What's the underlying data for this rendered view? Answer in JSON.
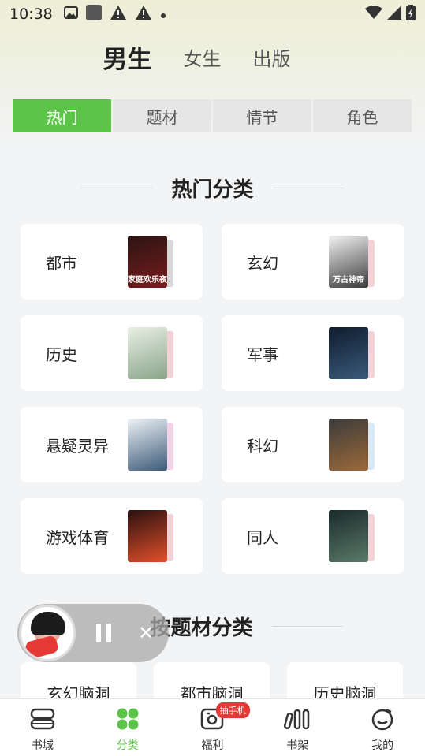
{
  "status_bar": {
    "time": "10:38"
  },
  "gender_tabs": [
    "男生",
    "女生",
    "出版"
  ],
  "segment_tabs": [
    "热门",
    "题材",
    "情节",
    "角色"
  ],
  "hot_section": {
    "title": "热门分类",
    "categories": [
      {
        "label": "都市",
        "cover_colors": [
          "#2b1414",
          "#7a1c1c"
        ],
        "cover_text": "家庭欢乐夜",
        "back_color": "#d8d8d8"
      },
      {
        "label": "玄幻",
        "cover_colors": [
          "#f2f2f2",
          "#3a3a3a"
        ],
        "cover_text": "万古神帝",
        "back_color": "#f2d2d6"
      },
      {
        "label": "历史",
        "cover_colors": [
          "#e8efe4",
          "#8aa48a"
        ],
        "cover_text": "",
        "back_color": "#f2d2d6"
      },
      {
        "label": "军事",
        "cover_colors": [
          "#0f1c2e",
          "#3a5a7a"
        ],
        "cover_text": "",
        "back_color": "#f2d2d6"
      },
      {
        "label": "悬疑灵异",
        "cover_colors": [
          "#eef2f6",
          "#3c5a78"
        ],
        "cover_text": "",
        "back_color": "#f2d2e6"
      },
      {
        "label": "科幻",
        "cover_colors": [
          "#3b3b3b",
          "#9c6a3a"
        ],
        "cover_text": "",
        "back_color": "#d9e8f5"
      },
      {
        "label": "游戏体育",
        "cover_colors": [
          "#2a1010",
          "#e2502a"
        ],
        "cover_text": "",
        "back_color": "#f2d2d6"
      },
      {
        "label": "同人",
        "cover_colors": [
          "#1a2a2a",
          "#5a7a6a"
        ],
        "cover_text": "",
        "back_color": "#f2d2d6"
      }
    ]
  },
  "topic_section": {
    "title": "按题材分类",
    "items": [
      "玄幻脑洞",
      "都市脑洞",
      "历史脑洞"
    ]
  },
  "bottom_nav": {
    "items": [
      {
        "label": "书城",
        "icon": "books-icon"
      },
      {
        "label": "分类",
        "icon": "category-icon"
      },
      {
        "label": "福利",
        "icon": "gift-icon",
        "badge": "抽手机"
      },
      {
        "label": "书架",
        "icon": "bookshelf-icon"
      },
      {
        "label": "我的",
        "icon": "profile-icon"
      }
    ],
    "active_index": 1
  },
  "colors": {
    "accent": "#5cc549",
    "badge": "#e53935"
  }
}
